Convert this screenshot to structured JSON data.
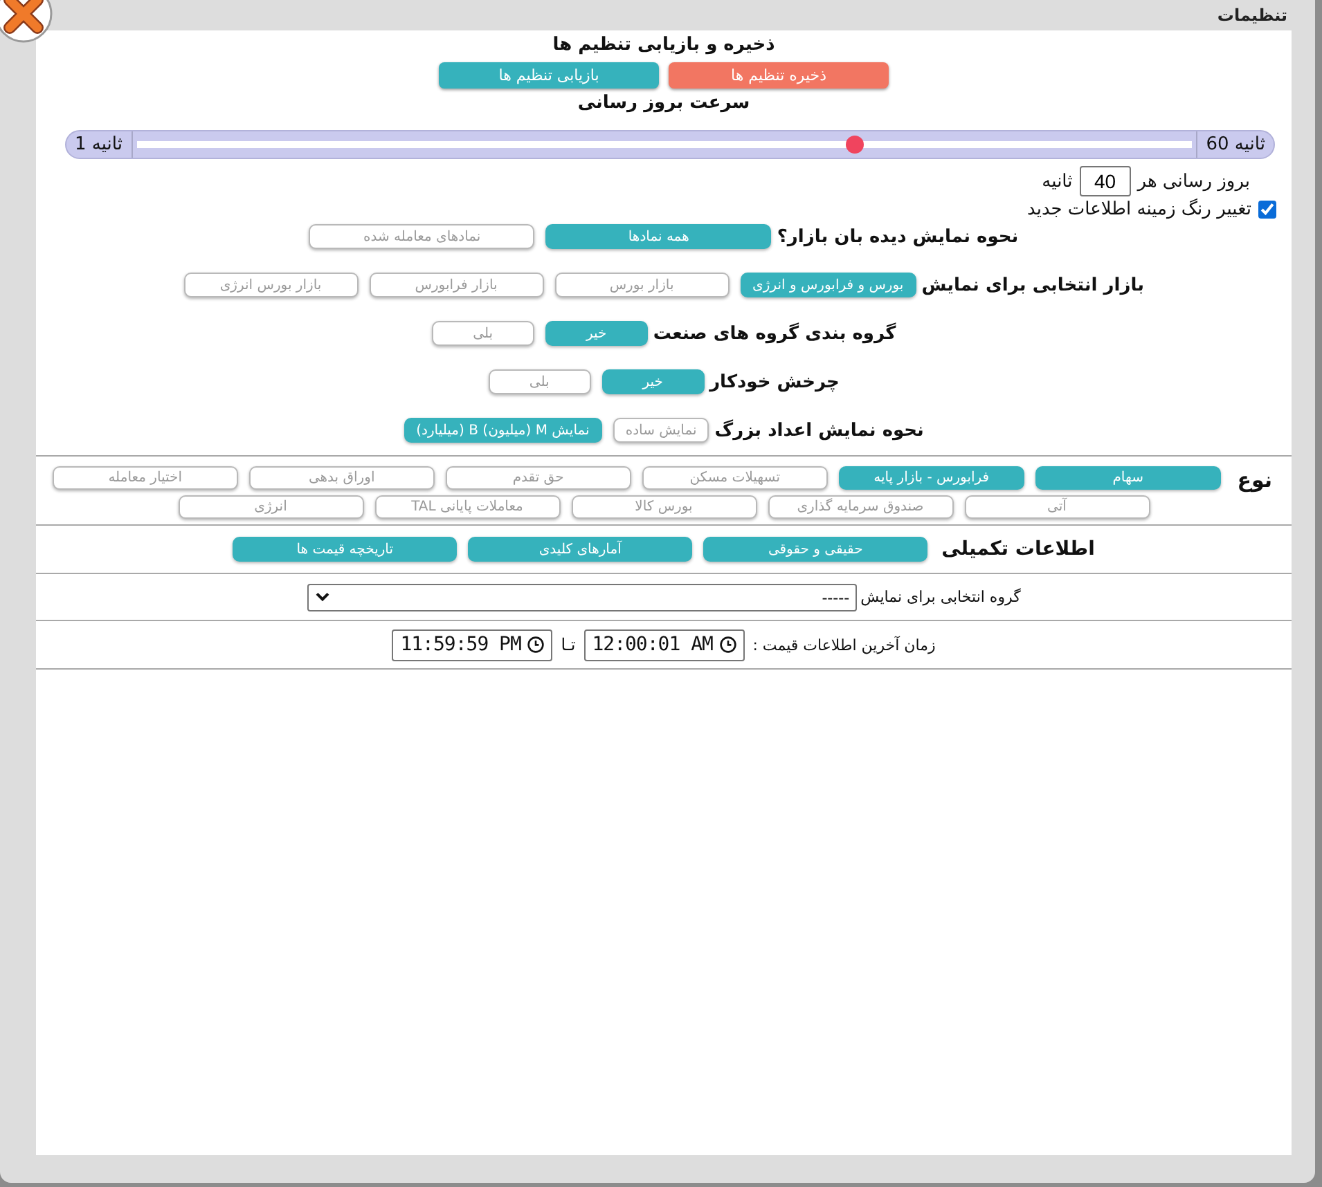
{
  "window": {
    "title": "تنظیمات"
  },
  "backup": {
    "title": "ذخیره و بازیابی تنظیم ها",
    "buttons": [
      {
        "kind": "save",
        "label": "ذخیره تنظیم ها"
      },
      {
        "kind": "restore",
        "label": "بازیابی تنظیم ها"
      }
    ]
  },
  "refresh_speed": {
    "title": "سرعت بروز رسانی",
    "max_label": "ثانیه 60",
    "min_label": "ثانیه 1",
    "level": 0.68,
    "interval": {
      "label": "بروز رسانی هر",
      "value": "40",
      "unit": "ثانیه"
    }
  },
  "highlight_new": {
    "label": "تغییر رنگ زمینه اطلاعات جدید",
    "checked": true
  },
  "options": [
    {
      "label": "نحوه نمایش دیده بان بازار؟",
      "choices": [
        {
          "label": "همه نمادها",
          "selected": true
        },
        {
          "label": "نمادهای معامله شده",
          "selected": false
        }
      ]
    },
    {
      "label": "بازار انتخابی برای نمایش",
      "choices": [
        {
          "label": "بورس و فرابورس و انرژی",
          "selected": true
        },
        {
          "label": "بازار بورس",
          "selected": false
        },
        {
          "label": "بازار فرابورس",
          "selected": false
        },
        {
          "label": "بازار بورس انرژی",
          "selected": false
        }
      ]
    },
    {
      "label": "گروه بندی گروه های صنعت",
      "choices": [
        {
          "label": "خیر",
          "selected": true
        },
        {
          "label": "بلی",
          "selected": false
        }
      ]
    },
    {
      "label": "چرخش خودکار",
      "choices": [
        {
          "label": "خیر",
          "selected": true
        },
        {
          "label": "بلی",
          "selected": false
        }
      ]
    },
    {
      "label": "نحوه نمایش اعداد بزرگ",
      "choices": [
        {
          "label": "نمایش ساده",
          "selected": false
        },
        {
          "label": "نمایش M (میلیون) B (میلیارد)",
          "selected": true
        }
      ]
    }
  ],
  "type_filter": {
    "label": "نوع",
    "choices": [
      {
        "label": "سهام",
        "selected": true
      },
      {
        "label": "فرابورس - بازار پایه",
        "selected": true
      },
      {
        "label": "تسهیلات مسکن",
        "selected": false
      },
      {
        "label": "حق تقدم",
        "selected": false
      },
      {
        "label": "اوراق بدهی",
        "selected": false
      },
      {
        "label": "اختیار معامله",
        "selected": false
      },
      {
        "label": "آتی",
        "selected": false
      },
      {
        "label": "صندوق سرمایه گذاری",
        "selected": false
      },
      {
        "label": "بورس کالا",
        "selected": false
      },
      {
        "label": "معاملات پایانی TAL",
        "selected": false
      },
      {
        "label": "انرژی",
        "selected": false
      }
    ]
  },
  "extra_info": {
    "label": "اطلاعات تکمیلی",
    "buttons": [
      "حقیقی و حقوقی",
      "آمارهای کلیدی",
      "تاریخچه قیمت ها"
    ]
  },
  "group_filter": {
    "label": "گروه انتخابی برای نمایش",
    "value": "-----"
  },
  "price_time": {
    "label": "زمان آخرین اطلاعات قیمت :",
    "from": "12:00:01 AM",
    "separator": "تـا",
    "to": "11:59:59 PM"
  }
}
